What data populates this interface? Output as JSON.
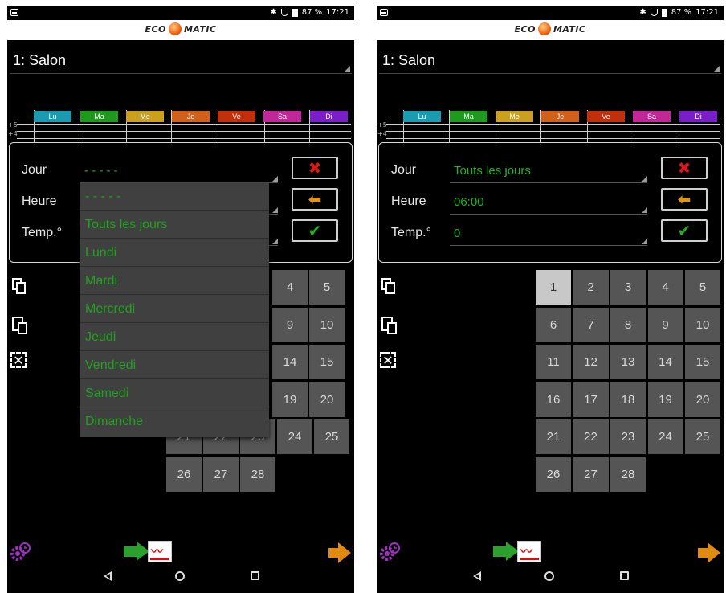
{
  "status": {
    "battery": "87 %",
    "time": "17:21",
    "bluetooth": "✱"
  },
  "brand": {
    "left": "ECO",
    "right": "MATIC"
  },
  "room": "1: Salon",
  "days": [
    {
      "label": "Lu",
      "color": "#1a9bb0"
    },
    {
      "label": "Ma",
      "color": "#1f9a1f"
    },
    {
      "label": "Me",
      "color": "#c9a020"
    },
    {
      "label": "Je",
      "color": "#d0601a"
    },
    {
      "label": "Ve",
      "color": "#c0300a"
    },
    {
      "label": "Sa",
      "color": "#c02898"
    },
    {
      "label": "Di",
      "color": "#7a1ec8"
    }
  ],
  "y_ticks": [
    "+5",
    "+4"
  ],
  "labels": {
    "jour": "Jour",
    "heure": "Heure",
    "temp": "Temp.°"
  },
  "left_screen": {
    "jour_value": "- - - - -",
    "heure_value": "",
    "temp_value": "",
    "dropdown": [
      "- - - - -",
      "Touts les jours",
      "Lundi",
      "Mardi",
      "Mercredi",
      "Jeudi",
      "Vendredi",
      "Samedi",
      "Dimanche"
    ],
    "calendar_partial": [
      "4",
      "5",
      "9",
      "10",
      "14",
      "15",
      "19",
      "20",
      "21",
      "22",
      "23",
      "24",
      "25",
      "26",
      "27",
      "28"
    ]
  },
  "right_screen": {
    "jour_value": "Touts les jours",
    "heure_value": "06:00",
    "temp_value": "0",
    "calendar": [
      "1",
      "2",
      "3",
      "4",
      "5",
      "6",
      "7",
      "8",
      "9",
      "10",
      "11",
      "12",
      "13",
      "14",
      "15",
      "16",
      "17",
      "18",
      "19",
      "20",
      "21",
      "22",
      "23",
      "24",
      "25",
      "26",
      "27",
      "28"
    ],
    "selected_day": "1"
  },
  "buttons": {
    "delete_glyph": "✖",
    "back_glyph": "⬅",
    "ok_glyph": "✔"
  },
  "icons": {
    "heat_glyph": "〰"
  }
}
